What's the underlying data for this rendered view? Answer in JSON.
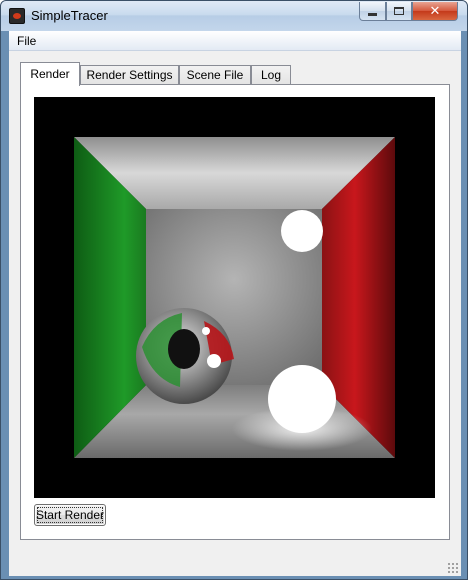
{
  "window": {
    "title": "SimpleTracer",
    "close_glyph": "✕",
    "icons": [
      "app-icon",
      "minimize-icon",
      "maximize-icon",
      "close-icon"
    ]
  },
  "menu": {
    "items": [
      {
        "label": "File"
      }
    ]
  },
  "tabs": [
    {
      "label": "Render",
      "active": true
    },
    {
      "label": "Render Settings",
      "active": false
    },
    {
      "label": "Scene File",
      "active": false
    },
    {
      "label": "Log",
      "active": false
    }
  ],
  "render_view": {
    "description_colors": {
      "left_wall": "#1f9a28",
      "right_wall": "#c8171c",
      "walls": "#b9b9b9",
      "background": "#000000"
    }
  },
  "actions": {
    "start_render_label": "Start Render"
  }
}
